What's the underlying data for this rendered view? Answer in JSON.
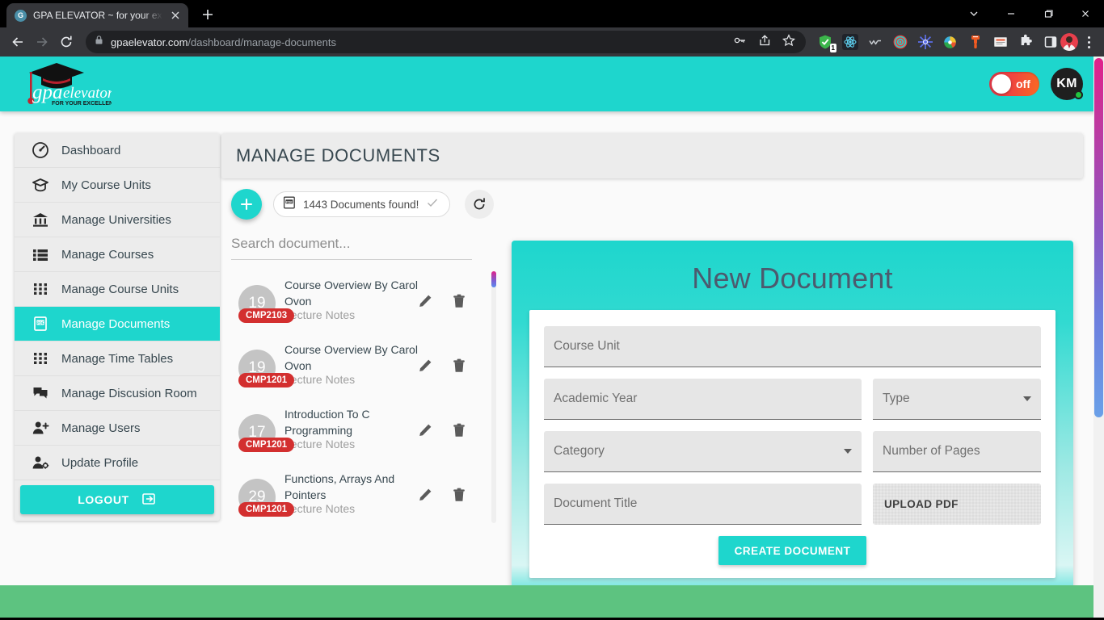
{
  "browser": {
    "tab": {
      "title": "GPA ELEVATOR ~ for your excelle",
      "favicon_letter": "G",
      "favicon_icon": "globe-favicon"
    },
    "new_tab_label": "+",
    "url_domain": "gpaelevator.com",
    "url_path": "/dashboard/manage-documents",
    "nav": {
      "back": "back-arrow",
      "forward": "forward-arrow",
      "reload": "reload-icon"
    },
    "omnibox_icons": [
      "lock-icon",
      "password-key-icon",
      "share-icon",
      "bookmark-star-icon"
    ],
    "extensions": [
      {
        "name": "shield-check-extension",
        "badge": "1"
      },
      {
        "name": "react-devtools-extension",
        "badge": ""
      },
      {
        "name": "wappalyzer-extension",
        "badge": ""
      },
      {
        "name": "target-circle-extension",
        "badge": ""
      },
      {
        "name": "sunburst-extension",
        "badge": ""
      },
      {
        "name": "colorpick-extension",
        "badge": ""
      },
      {
        "name": "honey-extension",
        "badge": ""
      },
      {
        "name": "notes-extension",
        "badge": ""
      },
      {
        "name": "puzzle-extensions-icon",
        "badge": ""
      },
      {
        "name": "sidepanel-icon",
        "badge": ""
      }
    ],
    "window_controls": [
      "chevron-down-icon",
      "minimize-icon",
      "maximize-icon",
      "close-icon"
    ]
  },
  "app": {
    "logo": {
      "brand": "gpa elevator",
      "tagline": "FOR YOUR EXCELLENCE"
    },
    "toggle": {
      "label": "off",
      "state": "off",
      "color": "#ef3b4e"
    },
    "user": {
      "initials": "KM",
      "presence": "online",
      "presence_color": "#21c43f"
    },
    "accent_color": "#1ed6cd",
    "footer_color": "#5dc380"
  },
  "sidebar": {
    "items": [
      {
        "label": "Dashboard",
        "icon": "speedometer-icon",
        "active": false
      },
      {
        "label": "My Course Units",
        "icon": "graduation-cap-icon",
        "active": false
      },
      {
        "label": "Manage Universities",
        "icon": "bank-icon",
        "active": false
      },
      {
        "label": "Manage Courses",
        "icon": "list-icon",
        "active": false
      },
      {
        "label": "Manage Course Units",
        "icon": "grid-dots-icon",
        "active": false
      },
      {
        "label": "Manage Documents",
        "icon": "pdf-file-icon",
        "active": true
      },
      {
        "label": "Manage Time Tables",
        "icon": "grid-dots-icon",
        "active": false
      },
      {
        "label": "Manage Discusion Room",
        "icon": "chat-bubbles-icon",
        "active": false
      },
      {
        "label": "Manage Users",
        "icon": "user-plus-icon",
        "active": false
      },
      {
        "label": "Update Profile",
        "icon": "user-gear-icon",
        "active": false
      }
    ],
    "logout_label": "LOGOUT",
    "logout_icon": "logout-arrow-icon"
  },
  "main": {
    "page_title": "MANAGE DOCUMENTS",
    "toolbar": {
      "add_label": "+",
      "count_text": "1443 Documents found!",
      "count_icon": "pdf-file-icon",
      "count_check_icon": "check-icon",
      "refresh_icon": "refresh-icon"
    },
    "search": {
      "placeholder": "Search document...",
      "value": ""
    },
    "documents": [
      {
        "pages": "19",
        "code": "CMP2103",
        "title": "Course Overview By Carol Ovon",
        "subtitle": "Lecture Notes"
      },
      {
        "pages": "19",
        "code": "CMP1201",
        "title": "Course Overview By Carol Ovon",
        "subtitle": "Lecture Notes"
      },
      {
        "pages": "17",
        "code": "CMP1201",
        "title": "Introduction To C Programming",
        "subtitle": "Lecture Notes"
      },
      {
        "pages": "29",
        "code": "CMP1201",
        "title": "Functions, Arrays And Pointers",
        "subtitle": "Lecture Notes"
      }
    ],
    "row_actions": {
      "edit_icon": "pencil-icon",
      "delete_icon": "trash-icon"
    }
  },
  "form": {
    "heading": "New Document",
    "fields": {
      "course_unit": {
        "placeholder": "Course Unit",
        "value": ""
      },
      "academic_year": {
        "placeholder": "Academic Year",
        "value": ""
      },
      "type": {
        "placeholder": "Type",
        "value": ""
      },
      "category": {
        "placeholder": "Category",
        "value": ""
      },
      "number_of_pages": {
        "placeholder": "Number of Pages",
        "value": ""
      },
      "document_title": {
        "placeholder": "Document Title",
        "value": ""
      }
    },
    "upload_label": "UPLOAD PDF",
    "submit_label": "CREATE DOCUMENT"
  }
}
